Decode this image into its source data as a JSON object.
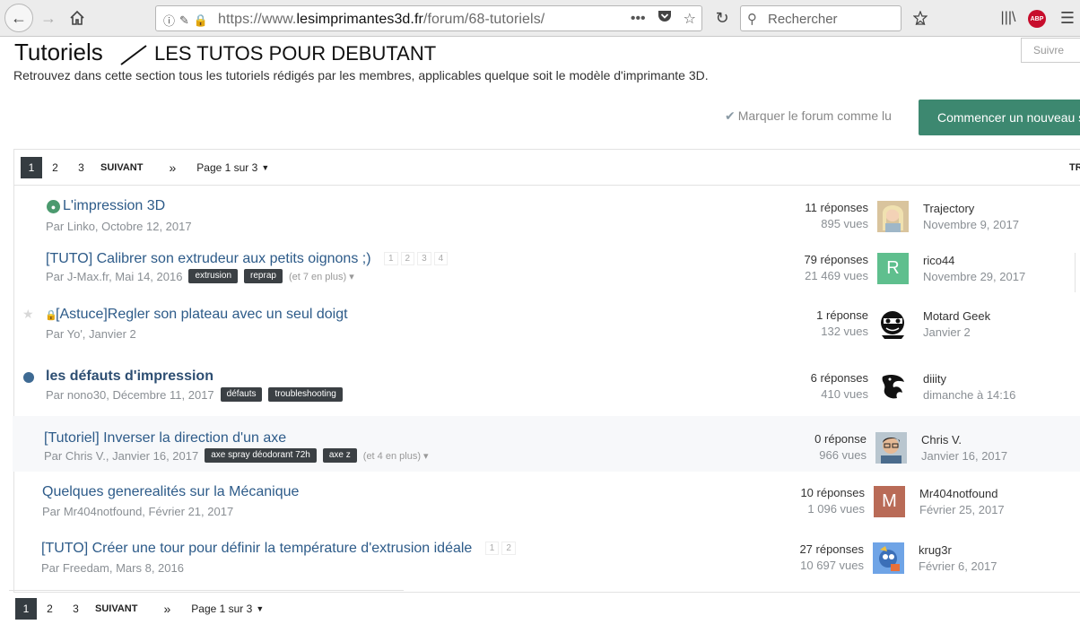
{
  "browser": {
    "url_prefix": "https://www.",
    "url_domain": "lesimprimantes3d.fr",
    "url_path": "/forum/68-tutoriels/",
    "search_placeholder": "Rechercher",
    "url_actions": "•••",
    "abp_label": "ABP"
  },
  "header": {
    "title": "Tutoriels",
    "subtitle": "LES TUTOS POUR DEBUTANT",
    "description": "Retrouvez dans cette section tous les tutoriels rédigés par les membres, applicables quelque soit le modèle d'imprimante 3D.",
    "follow_label": "Suivre",
    "mark_read_label": "Marquer le forum comme lu",
    "start_topic_label": "Commencer un nouveau s"
  },
  "pagination": {
    "current": "1",
    "pages": [
      "2",
      "3"
    ],
    "next_label": "SUIVANT",
    "last_label": "»",
    "jump_label": "Page 1 sur 3",
    "sort_label": "TRIER"
  },
  "topics": [
    {
      "title": "L'impression 3D",
      "meta": "Par Linko, Octobre 12, 2017",
      "replies": "11 réponses",
      "views": "895 vues",
      "last_user": "Trajectory",
      "last_date": "Novembre 9, 2017"
    },
    {
      "title": "[TUTO] Calibrer son extrudeur aux petits oignons ;)",
      "mini_pages": [
        "1",
        "2",
        "3",
        "4"
      ],
      "meta": "Par J-Max.fr, Mai 14, 2016",
      "tags": [
        "extrusion",
        "reprap"
      ],
      "more_tags": "(et 7 en plus) ▾",
      "replies": "79 réponses",
      "views": "21 469 vues",
      "avatar_letter": "R",
      "last_user": "rico44",
      "last_date": "Novembre 29, 2017"
    },
    {
      "title": "[Astuce]Regler son plateau avec un seul doigt",
      "meta": "Par Yo', Janvier 2",
      "replies": "1 réponse",
      "views": "132 vues",
      "last_user": "Motard Geek",
      "last_date": "Janvier 2"
    },
    {
      "title": "les défauts d'impression",
      "meta": "Par nono30, Décembre 11, 2017",
      "tags": [
        "défauts",
        "troubleshooting"
      ],
      "replies": "6 réponses",
      "views": "410 vues",
      "last_user": "diiity",
      "last_date": "dimanche à 14:16"
    },
    {
      "title": "[Tutoriel] Inverser la direction d'un axe",
      "meta": "Par Chris V., Janvier 16, 2017",
      "tags": [
        "axe spray déodorant 72h",
        "axe z"
      ],
      "more_tags": "(et 4 en plus) ▾",
      "replies": "0 réponse",
      "views": "966 vues",
      "last_user": "Chris V.",
      "last_date": "Janvier 16, 2017"
    },
    {
      "title": "Quelques generealités sur la Mécanique",
      "meta": "Par Mr404notfound, Février 21, 2017",
      "replies": "10 réponses",
      "views": "1 096 vues",
      "avatar_letter": "M",
      "last_user": "Mr404notfound",
      "last_date": "Février 25, 2017"
    },
    {
      "title": "[TUTO] Créer une tour pour définir la température d'extrusion idéale",
      "mini_pages": [
        "1",
        "2"
      ],
      "meta": "Par Freedam, Mars 8, 2016",
      "replies": "27 réponses",
      "views": "10 697 vues",
      "last_user": "krug3r",
      "last_date": "Février 6, 2017"
    }
  ],
  "colors": {
    "accent": "#3d8870",
    "link": "#2d5b89",
    "pager_current": "#353c41"
  }
}
